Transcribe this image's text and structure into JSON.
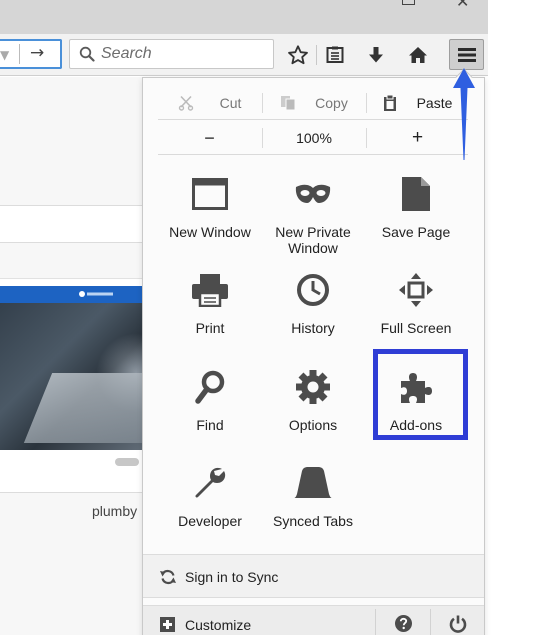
{
  "toolbar": {
    "search_placeholder": "Search"
  },
  "page": {
    "thumbnail_label": "plumby"
  },
  "panel": {
    "edit": {
      "cut": "Cut",
      "copy": "Copy",
      "paste": "Paste"
    },
    "zoom": {
      "minus": "−",
      "level": "100%",
      "plus": "+"
    },
    "items": [
      {
        "label": "New Window",
        "icon": "new-window-icon"
      },
      {
        "label": "New Private Window",
        "icon": "private-mask-icon"
      },
      {
        "label": "Save Page",
        "icon": "save-page-icon"
      },
      {
        "label": "Print",
        "icon": "printer-icon"
      },
      {
        "label": "History",
        "icon": "history-clock-icon"
      },
      {
        "label": "Full Screen",
        "icon": "full-screen-icon"
      },
      {
        "label": "Find",
        "icon": "magnifier-icon"
      },
      {
        "label": "Options",
        "icon": "gear-icon"
      },
      {
        "label": "Add-ons",
        "icon": "puzzle-piece-icon"
      },
      {
        "label": "Developer",
        "icon": "wrench-icon"
      },
      {
        "label": "Synced Tabs",
        "icon": "synced-tabs-icon"
      }
    ],
    "sign_in": "Sign in to Sync",
    "customize": "Customize"
  },
  "colors": {
    "highlight": "#2f3dd5",
    "annotation_arrow": "#2f5fe0",
    "icon": "#4c4c4c"
  }
}
